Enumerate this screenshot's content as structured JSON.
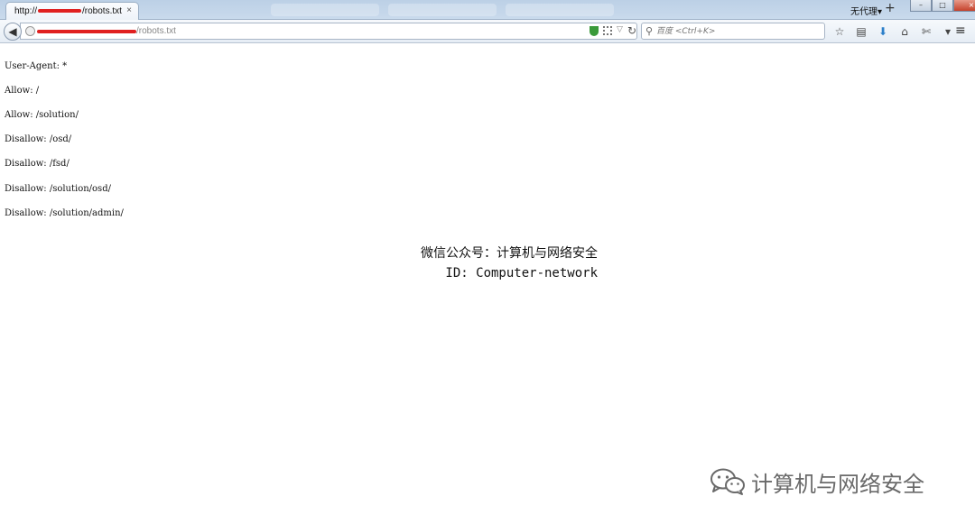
{
  "tabs": {
    "active": {
      "url_prefix": "http://",
      "url_suffix": "/robots.txt",
      "close_glyph": "×"
    },
    "new_tab_glyph": "+"
  },
  "proxy": {
    "label": "无代理▾"
  },
  "window_controls": {
    "minimize": "–",
    "maximize": "□",
    "close": "×"
  },
  "navbar": {
    "back_glyph": "◀",
    "url_path": "/robots.txt",
    "reload_glyph": "↻",
    "dropdown_glyph": "▽",
    "search_glyph": "⚲",
    "search_placeholder": "百度 <Ctrl+K>",
    "toolbar": [
      "☆",
      "▤",
      "⬇",
      "⌂",
      "✄",
      "▾"
    ],
    "menu_glyph": "≡"
  },
  "content": {
    "lines": [
      "User-Agent: *",
      "Allow: /",
      "Allow: /solution/",
      "Disallow: /osd/",
      "Disallow: /fsd/",
      "Disallow: /solution/osd/",
      "Disallow: /solution/admin/"
    ]
  },
  "overlay": {
    "line1": "微信公众号：计算机与网络安全",
    "line2": "ID: Computer-network"
  },
  "watermark": {
    "text": "计算机与网络安全"
  },
  "colors": {
    "redaction": "#e02020",
    "tab_strip": "#c9daec"
  },
  "icons": [
    "back-arrow-icon",
    "site-identity-icon",
    "shield-icon",
    "qr-code-icon",
    "reload-icon",
    "search-icon",
    "bookmark-star-icon",
    "reading-list-icon",
    "download-icon",
    "home-icon",
    "screenshot-icon",
    "menu-icon",
    "wechat-icon"
  ]
}
